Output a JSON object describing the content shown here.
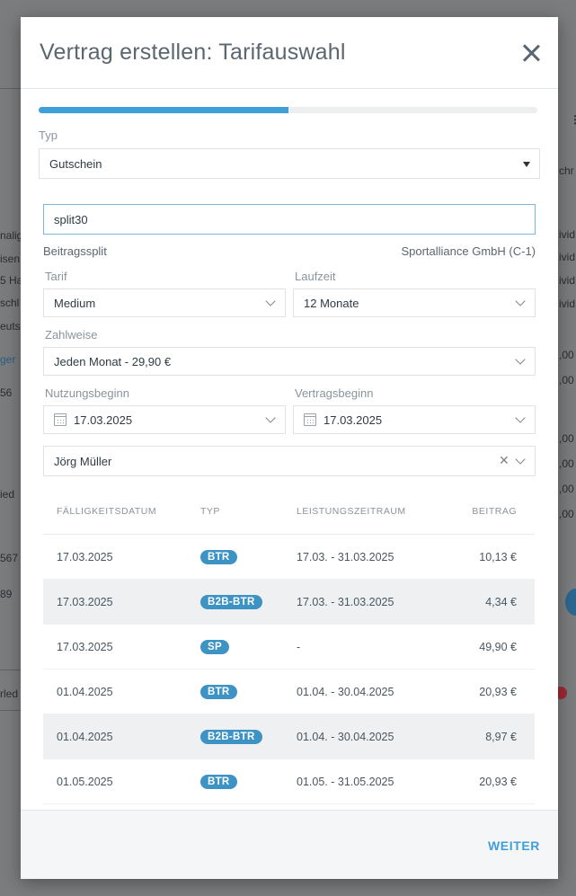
{
  "background": {
    "fragments": [
      "nalig",
      "isen",
      "5 Ha",
      "schl",
      "eutsc",
      "ger",
      "56",
      "ied",
      "567",
      "89",
      "rled",
      "chr",
      "ivid",
      "ivid",
      "ivid",
      "ivid",
      ",00",
      ",00",
      ",00",
      ",00",
      ",00",
      ",00"
    ]
  },
  "modal": {
    "title": "Vertrag erstellen: Tarifauswahl",
    "progress_fraction": 0.5,
    "type_label": "Typ",
    "type_value": "Gutschein",
    "voucher_code": "split30",
    "voucher_name": "Beitragssplit",
    "voucher_company": "Sportalliance GmbH (C-1)",
    "tarif_label": "Tarif",
    "tarif_value": "Medium",
    "laufzeit_label": "Laufzeit",
    "laufzeit_value": "12 Monate",
    "zahlweise_label": "Zahlweise",
    "zahlweise_value": "Jeden Monat - 29,90 €",
    "nutzungsbeginn_label": "Nutzungsbeginn",
    "nutzungsbeginn_value": "17.03.2025",
    "vertragsbeginn_label": "Vertragsbeginn",
    "vertragsbeginn_value": "17.03.2025",
    "member_value": "Jörg Müller",
    "table": {
      "headers": [
        "FÄLLIGKEITSDATUM",
        "TYP",
        "LEISTUNGSZEITRAUM",
        "BEITRAG"
      ],
      "rows": [
        {
          "date": "17.03.2025",
          "type": "BTR",
          "period": "17.03. - 31.03.2025",
          "amount": "10,13 €"
        },
        {
          "date": "17.03.2025",
          "type": "B2B-BTR",
          "period": "17.03. - 31.03.2025",
          "amount": "4,34 €"
        },
        {
          "date": "17.03.2025",
          "type": "SP",
          "period": "-",
          "amount": "49,90 €"
        },
        {
          "date": "01.04.2025",
          "type": "BTR",
          "period": "01.04. - 30.04.2025",
          "amount": "20,93 €"
        },
        {
          "date": "01.04.2025",
          "type": "B2B-BTR",
          "period": "01.04. - 30.04.2025",
          "amount": "8,97 €"
        },
        {
          "date": "01.05.2025",
          "type": "BTR",
          "period": "01.05. - 31.05.2025",
          "amount": "20,93 €"
        }
      ]
    },
    "next_label": "WEITER"
  },
  "colors": {
    "accent": "#3f9fd9",
    "badge": "#3d93c4"
  }
}
